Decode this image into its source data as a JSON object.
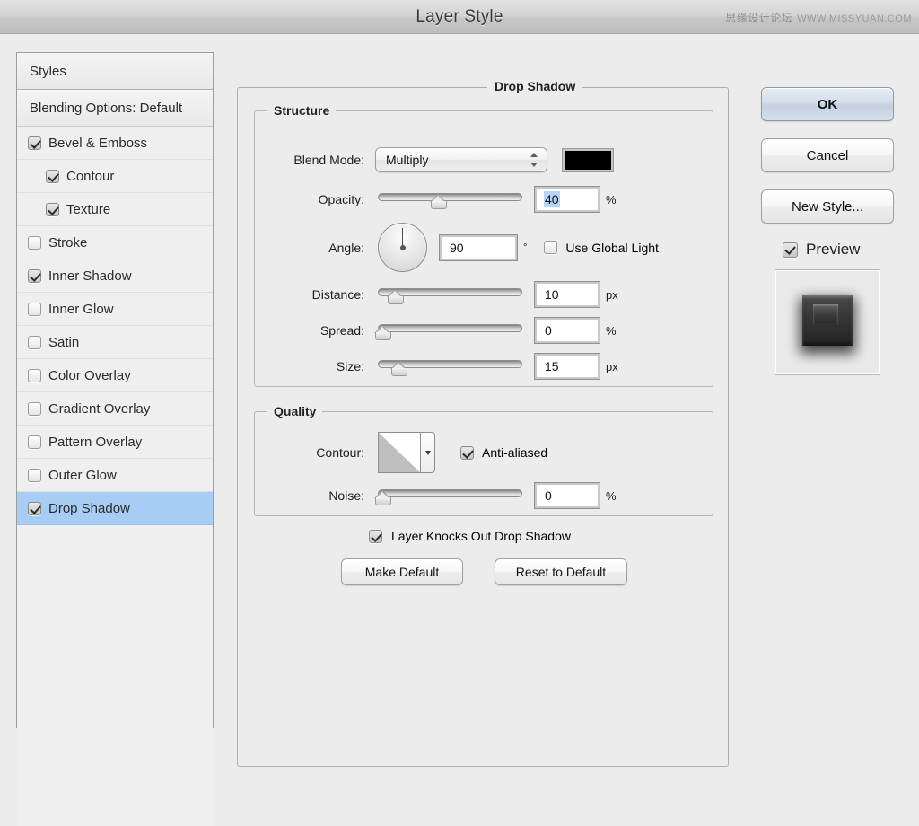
{
  "window": {
    "title": "Layer Style",
    "watermark_cn": "思缘设计论坛",
    "watermark_url": "WWW.MISSYUAN.COM"
  },
  "sidebar": {
    "header": "Styles",
    "blending_options": "Blending Options: Default",
    "items": [
      {
        "label": "Bevel & Emboss",
        "checked": true,
        "indent": false,
        "selected": false
      },
      {
        "label": "Contour",
        "checked": true,
        "indent": true,
        "selected": false
      },
      {
        "label": "Texture",
        "checked": true,
        "indent": true,
        "selected": false
      },
      {
        "label": "Stroke",
        "checked": false,
        "indent": false,
        "selected": false
      },
      {
        "label": "Inner Shadow",
        "checked": true,
        "indent": false,
        "selected": false
      },
      {
        "label": "Inner Glow",
        "checked": false,
        "indent": false,
        "selected": false
      },
      {
        "label": "Satin",
        "checked": false,
        "indent": false,
        "selected": false
      },
      {
        "label": "Color Overlay",
        "checked": false,
        "indent": false,
        "selected": false
      },
      {
        "label": "Gradient Overlay",
        "checked": false,
        "indent": false,
        "selected": false
      },
      {
        "label": "Pattern Overlay",
        "checked": false,
        "indent": false,
        "selected": false
      },
      {
        "label": "Outer Glow",
        "checked": false,
        "indent": false,
        "selected": false
      },
      {
        "label": "Drop Shadow",
        "checked": true,
        "indent": false,
        "selected": true
      }
    ]
  },
  "panel": {
    "title": "Drop Shadow",
    "structure": {
      "title": "Structure",
      "blend_mode_label": "Blend Mode:",
      "blend_mode_value": "Multiply",
      "shadow_color": "#000000",
      "opacity_label": "Opacity:",
      "opacity_value": "40",
      "opacity_unit": "%",
      "angle_label": "Angle:",
      "angle_value": "90",
      "angle_unit": "°",
      "use_global_light_label": "Use Global Light",
      "use_global_light_checked": false,
      "distance_label": "Distance:",
      "distance_value": "10",
      "distance_unit": "px",
      "spread_label": "Spread:",
      "spread_value": "0",
      "spread_unit": "%",
      "size_label": "Size:",
      "size_value": "15",
      "size_unit": "px"
    },
    "quality": {
      "title": "Quality",
      "contour_label": "Contour:",
      "anti_aliased_label": "Anti-aliased",
      "anti_aliased_checked": true,
      "noise_label": "Noise:",
      "noise_value": "0",
      "noise_unit": "%"
    },
    "knockout_label": "Layer Knocks Out Drop Shadow",
    "knockout_checked": true,
    "make_default_label": "Make Default",
    "reset_default_label": "Reset to Default"
  },
  "actions": {
    "ok_label": "OK",
    "cancel_label": "Cancel",
    "new_style_label": "New Style...",
    "preview_label": "Preview",
    "preview_checked": true
  },
  "colors": {
    "selection_blue": "#a8cdf4",
    "text_selection": "#b6d4f5",
    "dialog_bg": "#ececec"
  }
}
